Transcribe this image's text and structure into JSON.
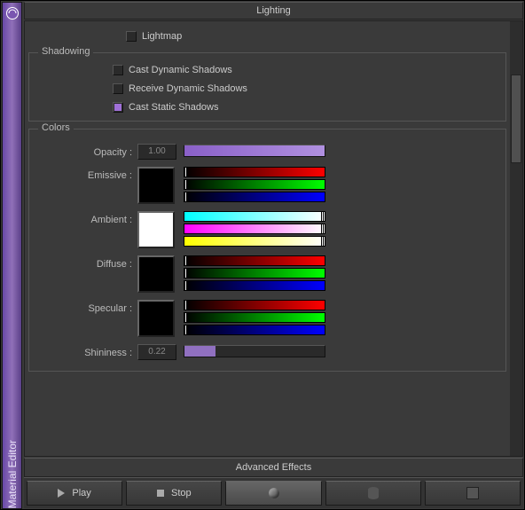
{
  "sidebar": {
    "title": "Material Editor"
  },
  "panel": {
    "title": "Lighting"
  },
  "lighting": {
    "lightmap": {
      "label": "Lightmap",
      "checked": false
    }
  },
  "shadowing": {
    "legend": "Shadowing",
    "castDynamic": {
      "label": "Cast Dynamic Shadows",
      "checked": false
    },
    "receiveDynamic": {
      "label": "Receive Dynamic Shadows",
      "checked": false
    },
    "castStatic": {
      "label": "Cast Static Shadows",
      "checked": true
    }
  },
  "colors": {
    "legend": "Colors",
    "opacity": {
      "label": "Opacity :",
      "value": "1.00",
      "fillPct": 100,
      "fillColor": "linear-gradient(90deg,#8a60c8,#b090e0)"
    },
    "emissive": {
      "label": "Emissive :",
      "swatch": "#000000",
      "tracks": [
        {
          "grad": "linear-gradient(90deg,#000,#f00)",
          "pos": 0
        },
        {
          "grad": "linear-gradient(90deg,#000,#0f0)",
          "pos": 0
        },
        {
          "grad": "linear-gradient(90deg,#000,#00f)",
          "pos": 0
        }
      ]
    },
    "ambient": {
      "label": "Ambient :",
      "swatch": "#ffffff",
      "tracks": [
        {
          "grad": "linear-gradient(90deg,#00ffff,#ffffff)",
          "pos": 100
        },
        {
          "grad": "linear-gradient(90deg,#ff00ff,#ffffff)",
          "pos": 100
        },
        {
          "grad": "linear-gradient(90deg,#ffff00,#ffffff)",
          "pos": 100
        }
      ]
    },
    "diffuse": {
      "label": "Diffuse :",
      "swatch": "#000000",
      "tracks": [
        {
          "grad": "linear-gradient(90deg,#000,#f00)",
          "pos": 0
        },
        {
          "grad": "linear-gradient(90deg,#000,#0f0)",
          "pos": 0
        },
        {
          "grad": "linear-gradient(90deg,#000,#00f)",
          "pos": 0
        }
      ]
    },
    "specular": {
      "label": "Specular :",
      "swatch": "#000000",
      "tracks": [
        {
          "grad": "linear-gradient(90deg,#000,#f00)",
          "pos": 0
        },
        {
          "grad": "linear-gradient(90deg,#000,#0f0)",
          "pos": 0
        },
        {
          "grad": "linear-gradient(90deg,#000,#00f)",
          "pos": 0
        }
      ]
    },
    "shininess": {
      "label": "Shininess :",
      "value": "0.22",
      "fillPct": 22,
      "fillColor": "#9070c0"
    }
  },
  "advanced": {
    "title": "Advanced Effects"
  },
  "bottombar": {
    "play": "Play",
    "stop": "Stop"
  }
}
